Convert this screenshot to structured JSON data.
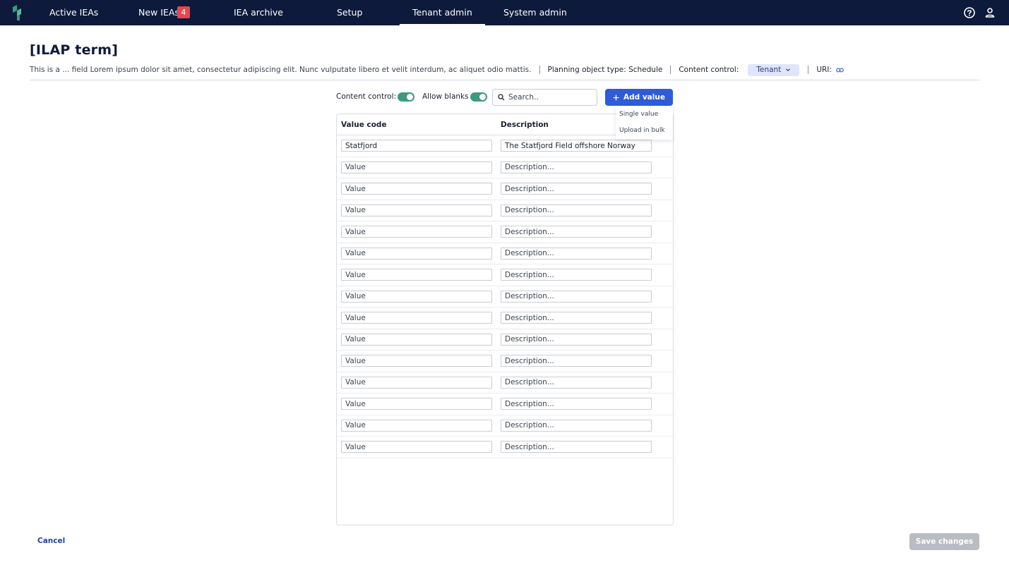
{
  "nav": {
    "logo_icon": "ilap-logo",
    "items": [
      {
        "label": "Active IEAs"
      },
      {
        "label": "New IEAs",
        "badge": "4"
      },
      {
        "label": "IEA archive"
      },
      {
        "label": "Setup"
      },
      {
        "label": "Tenant admin",
        "active": true
      },
      {
        "label": "System admin"
      }
    ],
    "right_icons": [
      "help-icon",
      "user-icon"
    ]
  },
  "header": {
    "title": "[ILAP term]",
    "description": "This is a ... field Lorem ipsum dolor sit amet, consectetur adipiscing elit. Nunc vulputate libero et velit interdum, ac aliquet odio mattis.",
    "planning_object_type": "Planning object type: Schedule",
    "content_control_label": "Content control:",
    "content_control_value": "Tenant",
    "uri_label": "URI:"
  },
  "toolbar": {
    "content_control_label": "Content control:",
    "content_control_on": true,
    "allow_blanks_label": "Allow blanks",
    "allow_blanks_on": true,
    "search_placeholder": "Search..",
    "add_value_label": "Add value"
  },
  "add_menu": {
    "items": [
      "Single value",
      "Upload in bulk"
    ]
  },
  "table": {
    "columns": [
      "Value code",
      "Description"
    ],
    "value_placeholder": "Value",
    "description_placeholder": "Description...",
    "rows": [
      {
        "code": "Statfjord",
        "description": "The Statfjord Field offshore Norway"
      },
      {
        "code": "",
        "description": ""
      },
      {
        "code": "",
        "description": ""
      },
      {
        "code": "",
        "description": ""
      },
      {
        "code": "",
        "description": ""
      },
      {
        "code": "",
        "description": ""
      },
      {
        "code": "",
        "description": ""
      },
      {
        "code": "",
        "description": ""
      },
      {
        "code": "",
        "description": ""
      },
      {
        "code": "",
        "description": ""
      },
      {
        "code": "",
        "description": ""
      },
      {
        "code": "",
        "description": ""
      },
      {
        "code": "",
        "description": ""
      },
      {
        "code": "",
        "description": ""
      },
      {
        "code": "",
        "description": ""
      }
    ]
  },
  "footer": {
    "cancel_label": "Cancel",
    "save_label": "Save changes"
  },
  "colors": {
    "nav_bg": "#0e1a3b",
    "accent": "#2f5bd8",
    "toggle_on": "#3e9a7e",
    "badge": "#e5484d",
    "disabled": "#b9bcc3"
  }
}
